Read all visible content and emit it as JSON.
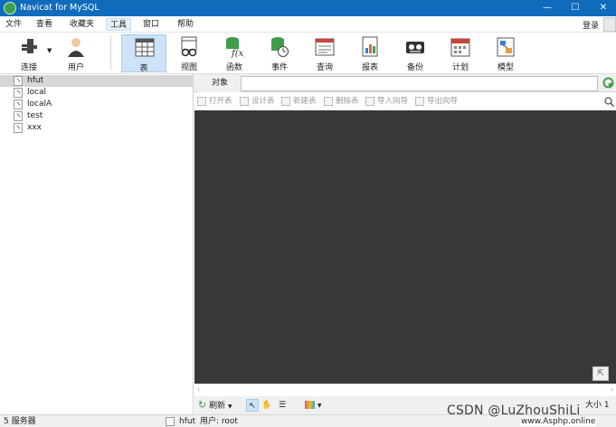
{
  "window": {
    "title": "Navicat for MySQL",
    "controls": [
      "minimize-icon",
      "maximize-icon",
      "close-icon"
    ]
  },
  "menu": {
    "items": [
      {
        "label": "文件"
      },
      {
        "label": "查看"
      },
      {
        "label": "收藏夹"
      },
      {
        "label": "工具"
      },
      {
        "label": "窗口"
      },
      {
        "label": "帮助"
      }
    ],
    "active": "工具",
    "login": "登录"
  },
  "toolbar": {
    "items": [
      {
        "label": "连接",
        "icon": "plug-icon"
      },
      {
        "label": "用户",
        "icon": "user-icon"
      },
      {
        "label": "表",
        "icon": "table-icon",
        "active": true
      },
      {
        "label": "视图",
        "icon": "view-glasses-icon"
      },
      {
        "label": "函数",
        "icon": "function-icon"
      },
      {
        "label": "事件",
        "icon": "event-clock-icon"
      },
      {
        "label": "查询",
        "icon": "query-icon"
      },
      {
        "label": "报表",
        "icon": "report-icon"
      },
      {
        "label": "备份",
        "icon": "backup-icon"
      },
      {
        "label": "计划",
        "icon": "calendar-icon"
      },
      {
        "label": "模型",
        "icon": "model-icon"
      }
    ]
  },
  "sidebar": {
    "connections": [
      {
        "name": "hfut",
        "selected": true
      },
      {
        "name": "local"
      },
      {
        "name": "localA"
      },
      {
        "name": "test"
      },
      {
        "name": "xxx"
      }
    ]
  },
  "tabs": {
    "object": "对象"
  },
  "object_toolbar": {
    "items": [
      {
        "label": "打开表"
      },
      {
        "label": "设计表"
      },
      {
        "label": "新建表"
      },
      {
        "label": "删除表"
      },
      {
        "label": "导入向导"
      },
      {
        "label": "导出向导"
      }
    ]
  },
  "bottom": {
    "refresh": "刷新",
    "size_label": "大小 1"
  },
  "status": {
    "server_count": "5 服务器",
    "connection": "hfut",
    "user": "用户: root"
  },
  "watermark": {
    "text": "CSDN @LuZhouShiLi",
    "site": "www.Asphp.online"
  },
  "colors": {
    "titlebar": "#0f6cbd",
    "content_bg": "#383838",
    "selected": "#cde3f7"
  }
}
